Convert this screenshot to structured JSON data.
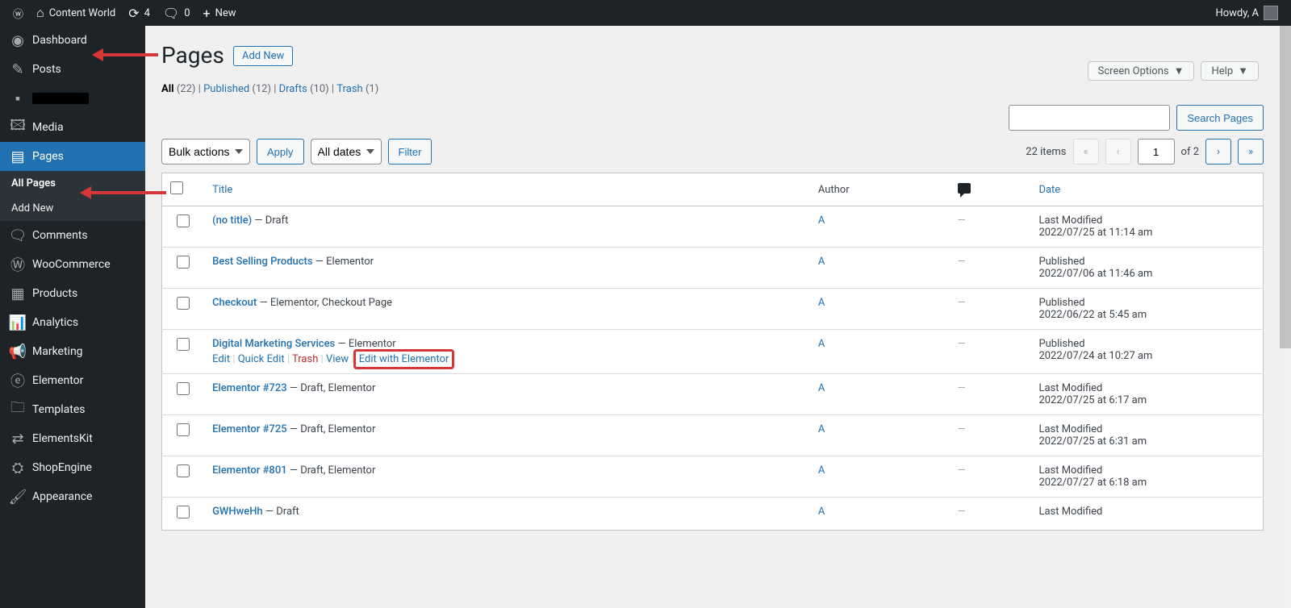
{
  "adminbar": {
    "site_name": "Content World",
    "updates": "4",
    "comments": "0",
    "new": "New",
    "howdy": "Howdy, A"
  },
  "sidebar": {
    "items": [
      {
        "label": "Dashboard",
        "id": "dashboard"
      },
      {
        "label": "Posts",
        "id": "posts"
      },
      {
        "label": "",
        "id": "redacted"
      },
      {
        "label": "Media",
        "id": "media"
      },
      {
        "label": "Pages",
        "id": "pages",
        "current": true
      },
      {
        "label": "Comments",
        "id": "comments"
      },
      {
        "label": "WooCommerce",
        "id": "woocommerce"
      },
      {
        "label": "Products",
        "id": "products"
      },
      {
        "label": "Analytics",
        "id": "analytics"
      },
      {
        "label": "Marketing",
        "id": "marketing"
      },
      {
        "label": "Elementor",
        "id": "elementor"
      },
      {
        "label": "Templates",
        "id": "templates"
      },
      {
        "label": "ElementsKit",
        "id": "elementskit"
      },
      {
        "label": "ShopEngine",
        "id": "shopengine"
      },
      {
        "label": "Appearance",
        "id": "appearance"
      }
    ],
    "submenu": [
      {
        "label": "All Pages",
        "current": true
      },
      {
        "label": "Add New"
      }
    ]
  },
  "topbuttons": {
    "screen_options": "Screen Options",
    "help": "Help"
  },
  "heading": "Pages",
  "add_new": "Add New",
  "filters": {
    "all": "All",
    "all_count": "(22)",
    "published": "Published",
    "published_count": "(12)",
    "drafts": "Drafts",
    "drafts_count": "(10)",
    "trash": "Trash",
    "trash_count": "(1)"
  },
  "bulk": {
    "label": "Bulk actions",
    "apply": "Apply",
    "dates": "All dates",
    "filter": "Filter"
  },
  "pagination": {
    "items": "22 items",
    "page": "1",
    "of": "of 2"
  },
  "search": {
    "button": "Search Pages"
  },
  "columns": {
    "title": "Title",
    "author": "Author",
    "date": "Date"
  },
  "row_actions": {
    "edit": "Edit",
    "quick_edit": "Quick Edit",
    "trash": "Trash",
    "view": "View",
    "elementor": "Edit with Elementor"
  },
  "rows": [
    {
      "title": "(no title)",
      "status": " — Draft",
      "author": "A",
      "date_status": "Last Modified",
      "date": "2022/07/25 at 11:14 am",
      "show_actions": false
    },
    {
      "title": "Best Selling Products",
      "status": " — Elementor",
      "author": "A",
      "date_status": "Published",
      "date": "2022/07/06 at 11:46 am",
      "show_actions": false
    },
    {
      "title": "Checkout",
      "status": " — Elementor, Checkout Page",
      "author": "A",
      "date_status": "Published",
      "date": "2022/06/22 at 5:45 am",
      "show_actions": false
    },
    {
      "title": "Digital Marketing Services",
      "status": " — Elementor",
      "author": "A",
      "date_status": "Published",
      "date": "2022/07/24 at 10:27 am",
      "show_actions": true
    },
    {
      "title": "Elementor #723",
      "status": " — Draft, Elementor",
      "author": "A",
      "date_status": "Last Modified",
      "date": "2022/07/25 at 6:17 am",
      "show_actions": false
    },
    {
      "title": "Elementor #725",
      "status": " — Draft, Elementor",
      "author": "A",
      "date_status": "Last Modified",
      "date": "2022/07/25 at 6:31 am",
      "show_actions": false
    },
    {
      "title": "Elementor #801",
      "status": " — Draft, Elementor",
      "author": "A",
      "date_status": "Last Modified",
      "date": "2022/07/27 at 6:18 am",
      "show_actions": false
    },
    {
      "title": "GWHweHh",
      "status": " — Draft",
      "author": "A",
      "date_status": "Last Modified",
      "date": "",
      "show_actions": false
    }
  ]
}
